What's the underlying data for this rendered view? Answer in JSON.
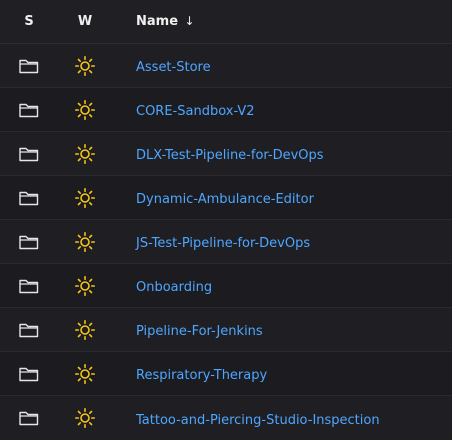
{
  "header": {
    "status_label": "S",
    "weather_label": "W",
    "name_label": "Name",
    "sort_indicator": "↓"
  },
  "colors": {
    "link": "#4ea6ff",
    "sun_icon": "#f5c518",
    "folder_icon": "#e6e6e6"
  },
  "jobs": [
    {
      "name": "Asset-Store",
      "status_icon": "folder-icon",
      "weather_icon": "sun-icon"
    },
    {
      "name": "CORE-Sandbox-V2",
      "status_icon": "folder-icon",
      "weather_icon": "sun-icon"
    },
    {
      "name": "DLX-Test-Pipeline-for-DevOps",
      "status_icon": "folder-icon",
      "weather_icon": "sun-icon"
    },
    {
      "name": "Dynamic-Ambulance-Editor",
      "status_icon": "folder-icon",
      "weather_icon": "sun-icon"
    },
    {
      "name": "JS-Test-Pipeline-for-DevOps",
      "status_icon": "folder-icon",
      "weather_icon": "sun-icon"
    },
    {
      "name": "Onboarding",
      "status_icon": "folder-icon",
      "weather_icon": "sun-icon"
    },
    {
      "name": "Pipeline-For-Jenkins",
      "status_icon": "folder-icon",
      "weather_icon": "sun-icon"
    },
    {
      "name": "Respiratory-Therapy",
      "status_icon": "folder-icon",
      "weather_icon": "sun-icon"
    },
    {
      "name": "Tattoo-and-Piercing-Studio-Inspection",
      "status_icon": "folder-icon",
      "weather_icon": "sun-icon"
    }
  ]
}
